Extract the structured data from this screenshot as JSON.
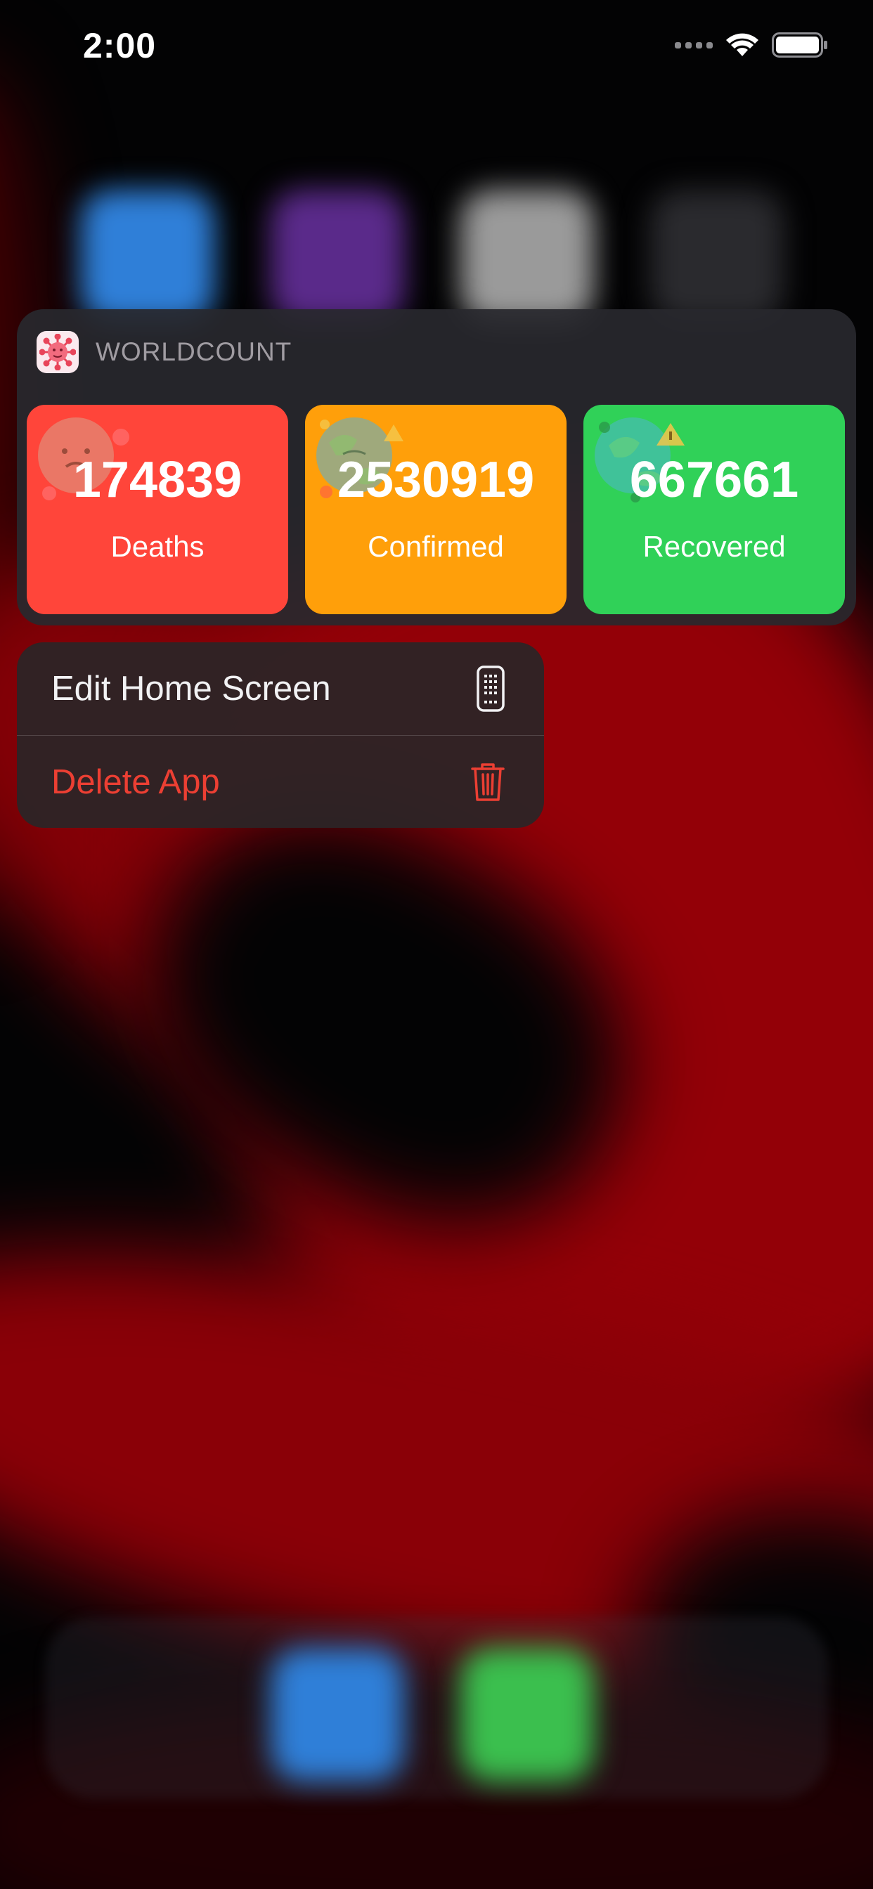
{
  "status_bar": {
    "time": "2:00"
  },
  "widget": {
    "app_name": "WORLDCOUNT",
    "cards": [
      {
        "value": "174839",
        "label": "Deaths",
        "color": "#ff453a"
      },
      {
        "value": "2530919",
        "label": "Confirmed",
        "color": "#ff9f0a"
      },
      {
        "value": "667661",
        "label": "Recovered",
        "color": "#30d158"
      }
    ]
  },
  "menu": {
    "items": [
      {
        "label": "Edit Home Screen",
        "icon": "phone-grid-icon",
        "color": "#f2f2f4"
      },
      {
        "label": "Delete App",
        "icon": "trash-icon",
        "color": "#ec3f33"
      }
    ]
  }
}
